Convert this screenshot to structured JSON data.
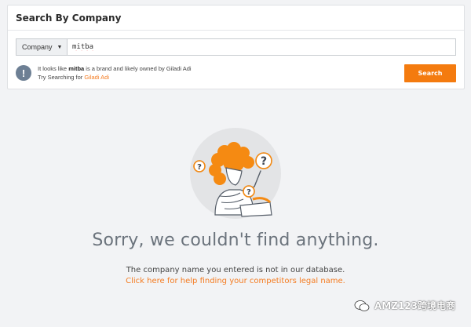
{
  "panel": {
    "title": "Search By Company"
  },
  "search": {
    "type_label": "Company",
    "type_caret": "▼",
    "query": "mitba"
  },
  "notice": {
    "icon": "!",
    "line1_prefix": "It looks like ",
    "brand": "mitba",
    "line1_mid": " is a brand and likely owned by ",
    "owner": "Giladi Adi",
    "line2_prefix": "Try Searching for ",
    "suggestion": "Giladi Adi"
  },
  "search_button": {
    "label": "Search"
  },
  "empty_state": {
    "title": "Sorry, we couldn't find anything.",
    "subtitle": "The company name you entered is not in our database.",
    "help_link": "Click here for help finding your competitors legal name."
  },
  "watermark": {
    "text": "AMZ123跨境电商"
  },
  "colors": {
    "accent": "#f47b0f",
    "link": "#f47b20",
    "info_icon": "#6d7f94",
    "page_bg": "#f2f3f5"
  }
}
